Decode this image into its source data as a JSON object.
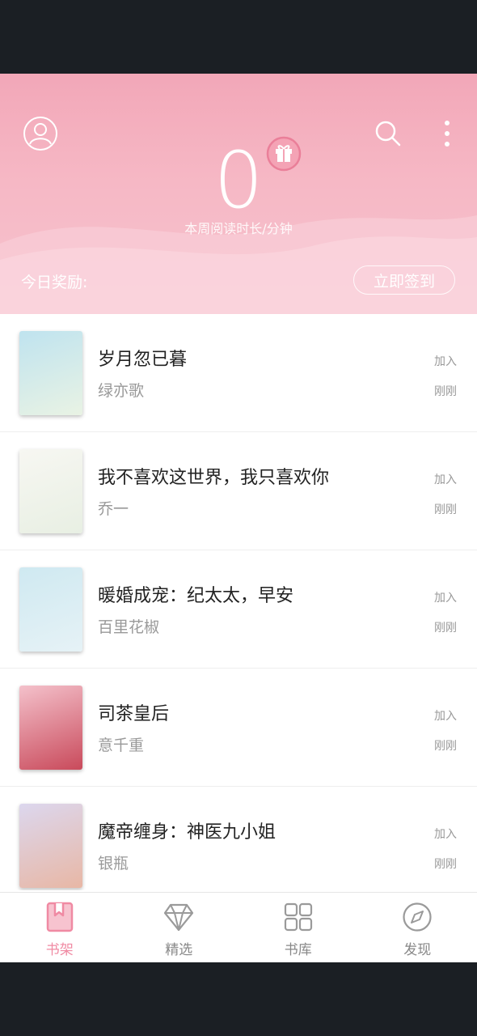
{
  "header": {
    "reading_minutes": "0",
    "reading_caption": "本周阅读时长/分钟",
    "reward_label": "今日奖励:",
    "signin_label": "立即签到"
  },
  "books": [
    {
      "title": "岁月忽已暮",
      "author": "绿亦歌",
      "status": "加入",
      "time": "刚刚",
      "cover_colors": [
        "#bfe3ef",
        "#e9f3e4"
      ]
    },
    {
      "title": "我不喜欢这世界，我只喜欢你",
      "author": "乔一",
      "status": "加入",
      "time": "刚刚",
      "cover_colors": [
        "#f7f7f2",
        "#e8efe3"
      ]
    },
    {
      "title": "暖婚成宠：纪太太，早安",
      "author": "百里花椒",
      "status": "加入",
      "time": "刚刚",
      "cover_colors": [
        "#cfe9f1",
        "#e6f2f6"
      ]
    },
    {
      "title": "司茶皇后",
      "author": "意千重",
      "status": "加入",
      "time": "刚刚",
      "cover_colors": [
        "#f4c1cb",
        "#c94a5b"
      ]
    },
    {
      "title": "魔帝缠身：神医九小姐",
      "author": "银瓶",
      "status": "加入",
      "time": "刚刚",
      "cover_colors": [
        "#dcd7ee",
        "#e8b7a5"
      ]
    }
  ],
  "tabs": [
    {
      "label": "书架",
      "icon": "bookshelf-icon",
      "active": true
    },
    {
      "label": "精选",
      "icon": "diamond-icon",
      "active": false
    },
    {
      "label": "书库",
      "icon": "grid-icon",
      "active": false
    },
    {
      "label": "发现",
      "icon": "compass-icon",
      "active": false
    }
  ],
  "colors": {
    "accent": "#f08aa3",
    "header_top": "#f2a7b8",
    "header_bottom": "#f7c3ce",
    "muted": "#999999"
  }
}
